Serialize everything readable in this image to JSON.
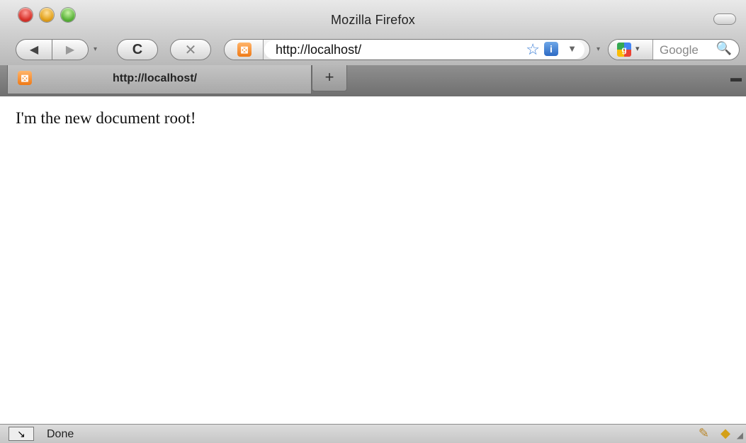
{
  "window": {
    "title": "Mozilla Firefox"
  },
  "nav": {
    "back_glyph": "◀",
    "forward_glyph": "▶",
    "reload_glyph": "C",
    "stop_glyph": "✕",
    "history_dropdown_glyph": "▾"
  },
  "urlbar": {
    "value": "http://localhost/",
    "favicon_glyph": "⊠",
    "star_glyph": "☆",
    "info_glyph": "i",
    "dropdown_glyph": "▼"
  },
  "search": {
    "placeholder": "Google",
    "engine_glyph": "g",
    "engine_dropdown_glyph": "▾",
    "separator_glyph": "▾",
    "search_glyph": "🔍"
  },
  "tabs": {
    "items": [
      {
        "label": "http://localhost/",
        "favicon_glyph": "⊠"
      }
    ],
    "new_tab_glyph": "+",
    "list_all_glyph": "▬"
  },
  "page": {
    "body_text": "I'm the new document root!"
  },
  "status": {
    "text": "Done",
    "activity_glyph": "↘",
    "addon1_glyph": "✎",
    "addon2_glyph": "◆",
    "resize_glyph": "◢"
  },
  "colors": {
    "close": "#d9332b",
    "minimize": "#e3a21c",
    "zoom": "#5bb43a",
    "favicon": "#f07a16",
    "info_icon": "#2d6ac4",
    "star": "#3d7fd6"
  }
}
